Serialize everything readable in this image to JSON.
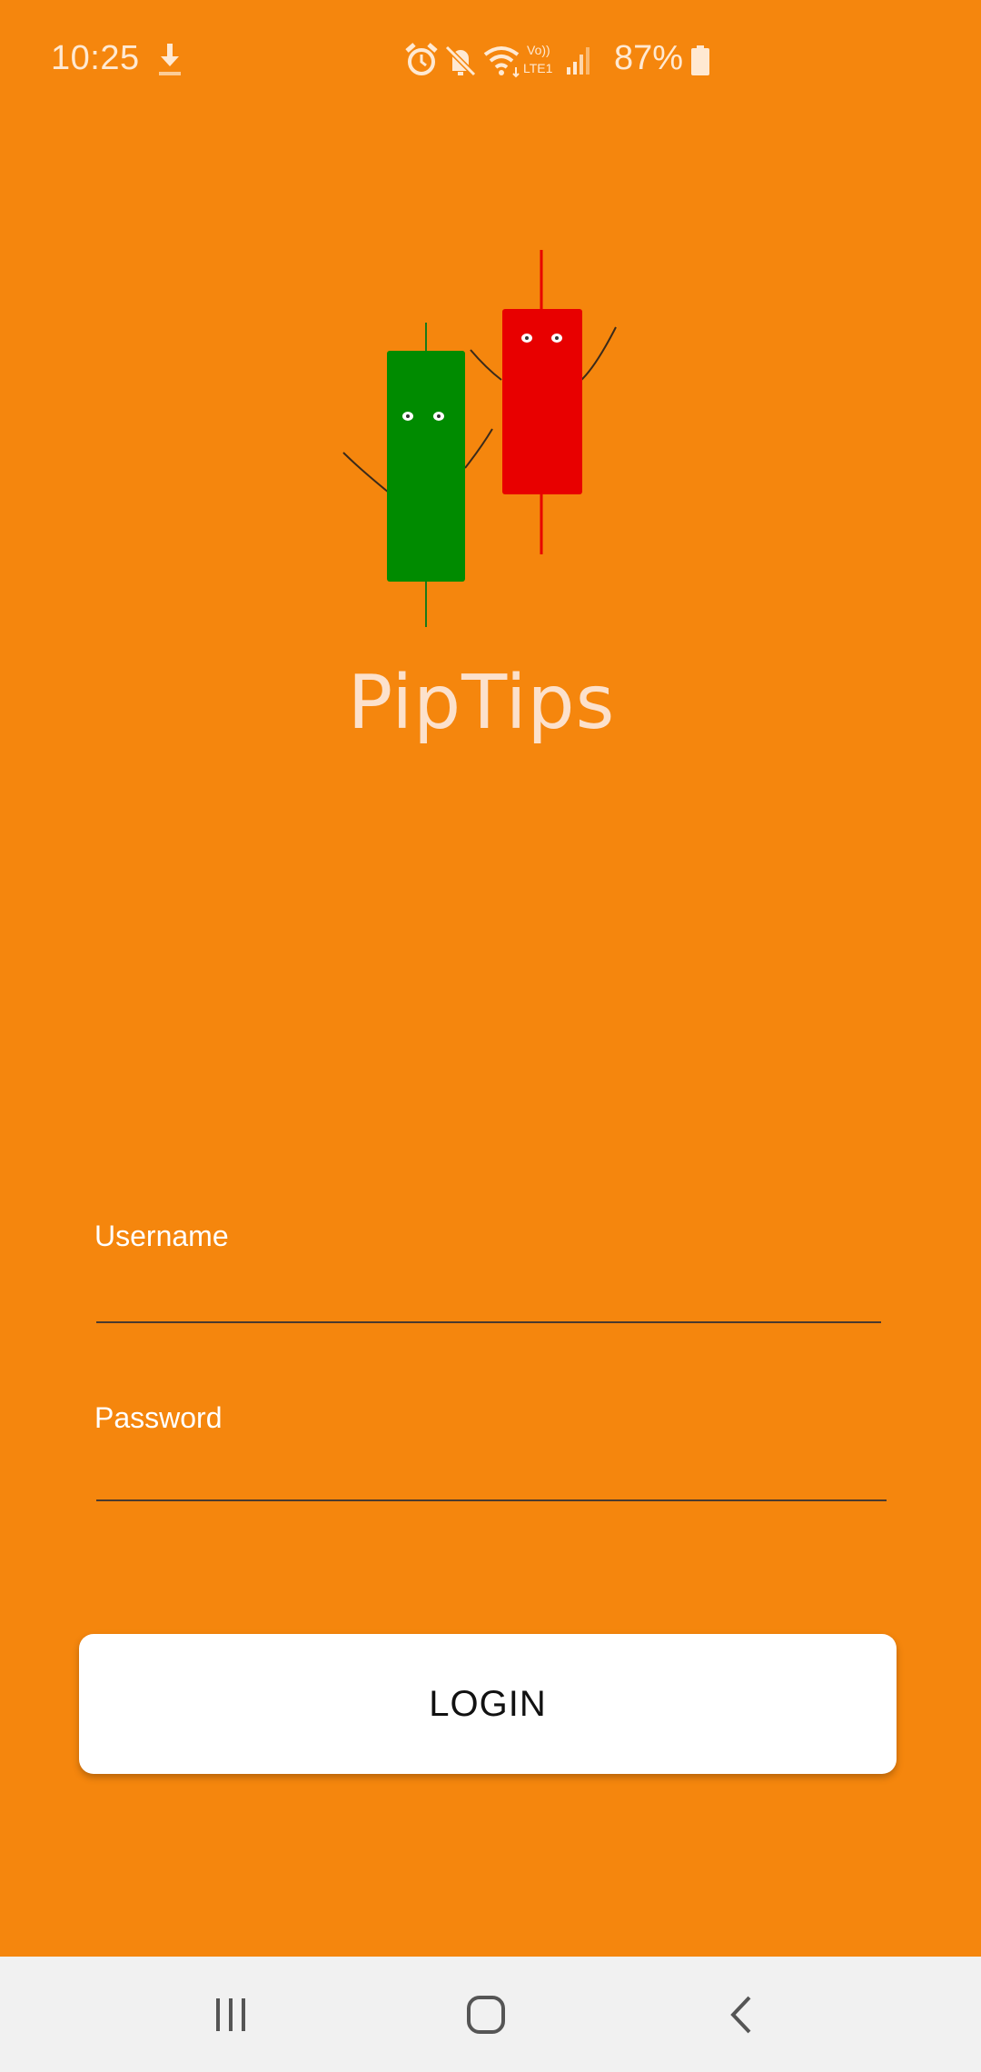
{
  "status_bar": {
    "time": "10:25",
    "battery_percent": "87%",
    "icons": [
      "download-icon",
      "alarm-icon",
      "mute-icon",
      "wifi-icon",
      "volte-lte-icon",
      "signal-icon",
      "battery-icon"
    ],
    "volte_top": "Vo))",
    "volte_bottom": "LTE1"
  },
  "app": {
    "name": "PipTips",
    "logo": "candlestick-characters-logo",
    "colors": {
      "background": "#F5860D",
      "green_candle": "#008B00",
      "red_candle": "#E80000"
    }
  },
  "form": {
    "username_label": "Username",
    "username_value": "",
    "password_label": "Password",
    "password_value": "",
    "login_label": "LOGIN"
  },
  "nav_bar": {
    "buttons": [
      "recents-icon",
      "home-icon",
      "back-icon"
    ]
  }
}
